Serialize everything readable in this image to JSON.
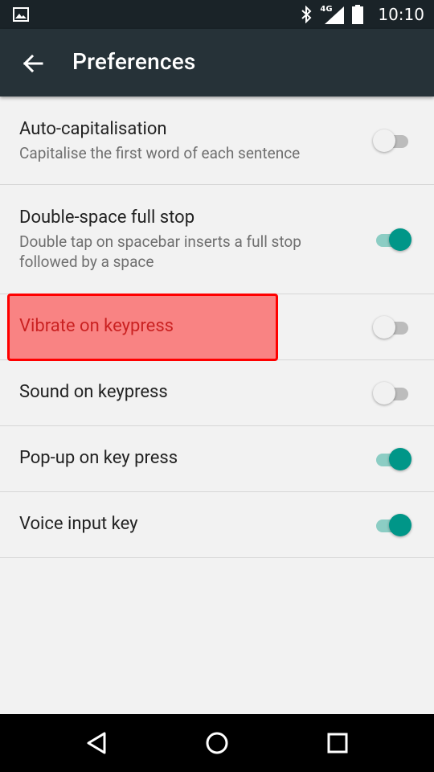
{
  "status_bar": {
    "time": "10:10",
    "network": "4G",
    "icons": [
      "image-notification-icon",
      "bluetooth-icon",
      "signal-icon",
      "battery-icon"
    ]
  },
  "app_bar": {
    "title": "Preferences",
    "back_icon": "arrow-back-icon"
  },
  "preferences": [
    {
      "label": "Auto-capitalisation",
      "summary": "Capitalise the first word of each sentence",
      "enabled": false
    },
    {
      "label": "Double-space full stop",
      "summary": "Double tap on spacebar inserts a full stop followed by a space",
      "enabled": true
    },
    {
      "label": "Vibrate on keypress",
      "summary": "",
      "enabled": false
    },
    {
      "label": "Sound on keypress",
      "summary": "",
      "enabled": false
    },
    {
      "label": "Pop-up on key press",
      "summary": "",
      "enabled": true
    },
    {
      "label": "Voice input key",
      "summary": "",
      "enabled": true
    }
  ],
  "colors": {
    "accent": "#009688",
    "accent_track": "#8ccdc4",
    "app_bar": "#263238",
    "status_bar": "#1a2328",
    "highlight": "#ff0000"
  },
  "nav_bar": {
    "icons": [
      "back-triangle-icon",
      "home-circle-icon",
      "recents-square-icon"
    ]
  }
}
